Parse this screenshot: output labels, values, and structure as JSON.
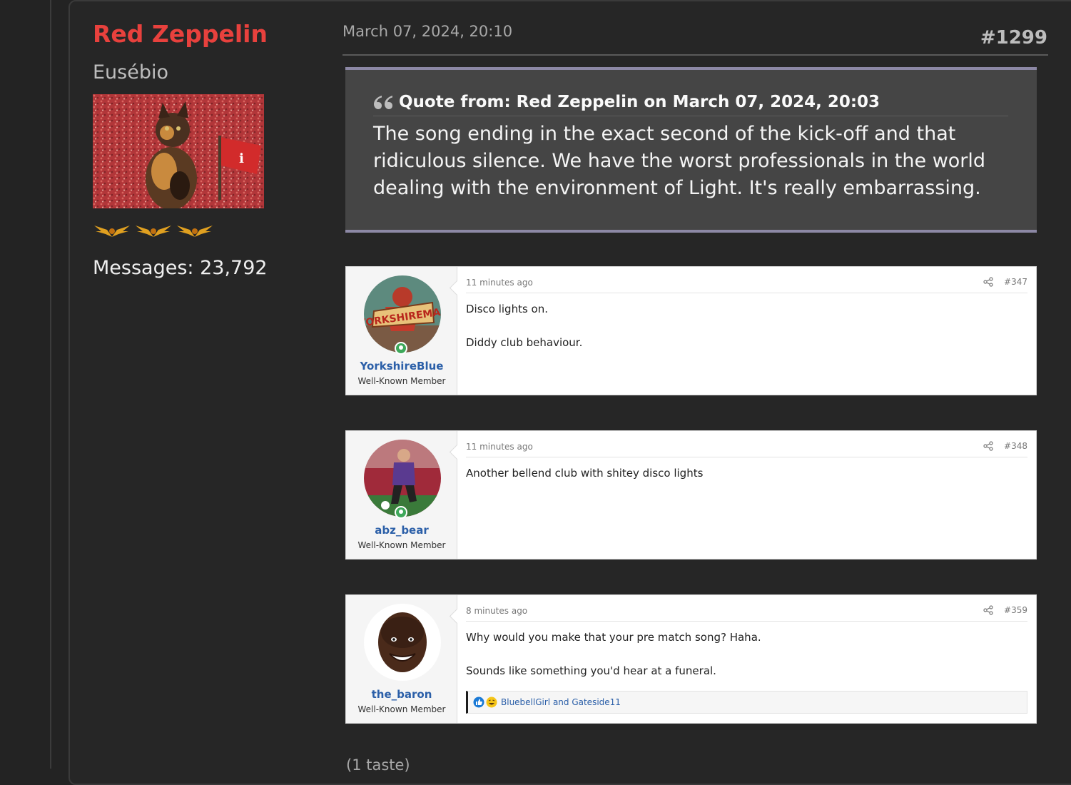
{
  "author": {
    "name": "Red Zeppelin",
    "title": "Eusébio",
    "avatar_icon": "cat-with-flag-avatar",
    "rank_icon": "golden-eagle-icon",
    "rank_count": 3,
    "messages": "Messages: 23,792"
  },
  "post": {
    "date": "March 07, 2024, 20:10",
    "number": "#1299",
    "quote": {
      "header": "Quote from: Red Zeppelin on March 07, 2024, 20:03",
      "body": "The song ending in the exact second of the kick-off and that ridiculous silence. We have the worst professionals in the world dealing with the environment of Light. It's really embarrassing."
    },
    "embedded_posts": [
      {
        "user": "YorkshireBlue",
        "role": "Well-Known Member",
        "time": "11 minutes ago",
        "number": "#347",
        "lines": [
          "Disco lights on.",
          "Diddy club behaviour."
        ],
        "online": true
      },
      {
        "user": "abz_bear",
        "role": "Well-Known Member",
        "time": "11 minutes ago",
        "number": "#348",
        "lines": [
          "Another bellend club with shitey disco lights"
        ],
        "online": true
      },
      {
        "user": "the_baron",
        "role": "Well-Known Member",
        "time": "8 minutes ago",
        "number": "#359",
        "lines": [
          "Why would you make that your pre match song? Haha.",
          "Sounds like something you'd hear at a funeral."
        ],
        "online": false,
        "reactions": "BluebellGirl and Gateside11"
      }
    ],
    "footer_partial": "(1 taste)"
  },
  "colors": {
    "background": "#232323",
    "author_name": "#e8413d",
    "quote_border": "#8c88a5",
    "link_blue": "#2b5fa8",
    "online_green": "#3ea85a"
  }
}
